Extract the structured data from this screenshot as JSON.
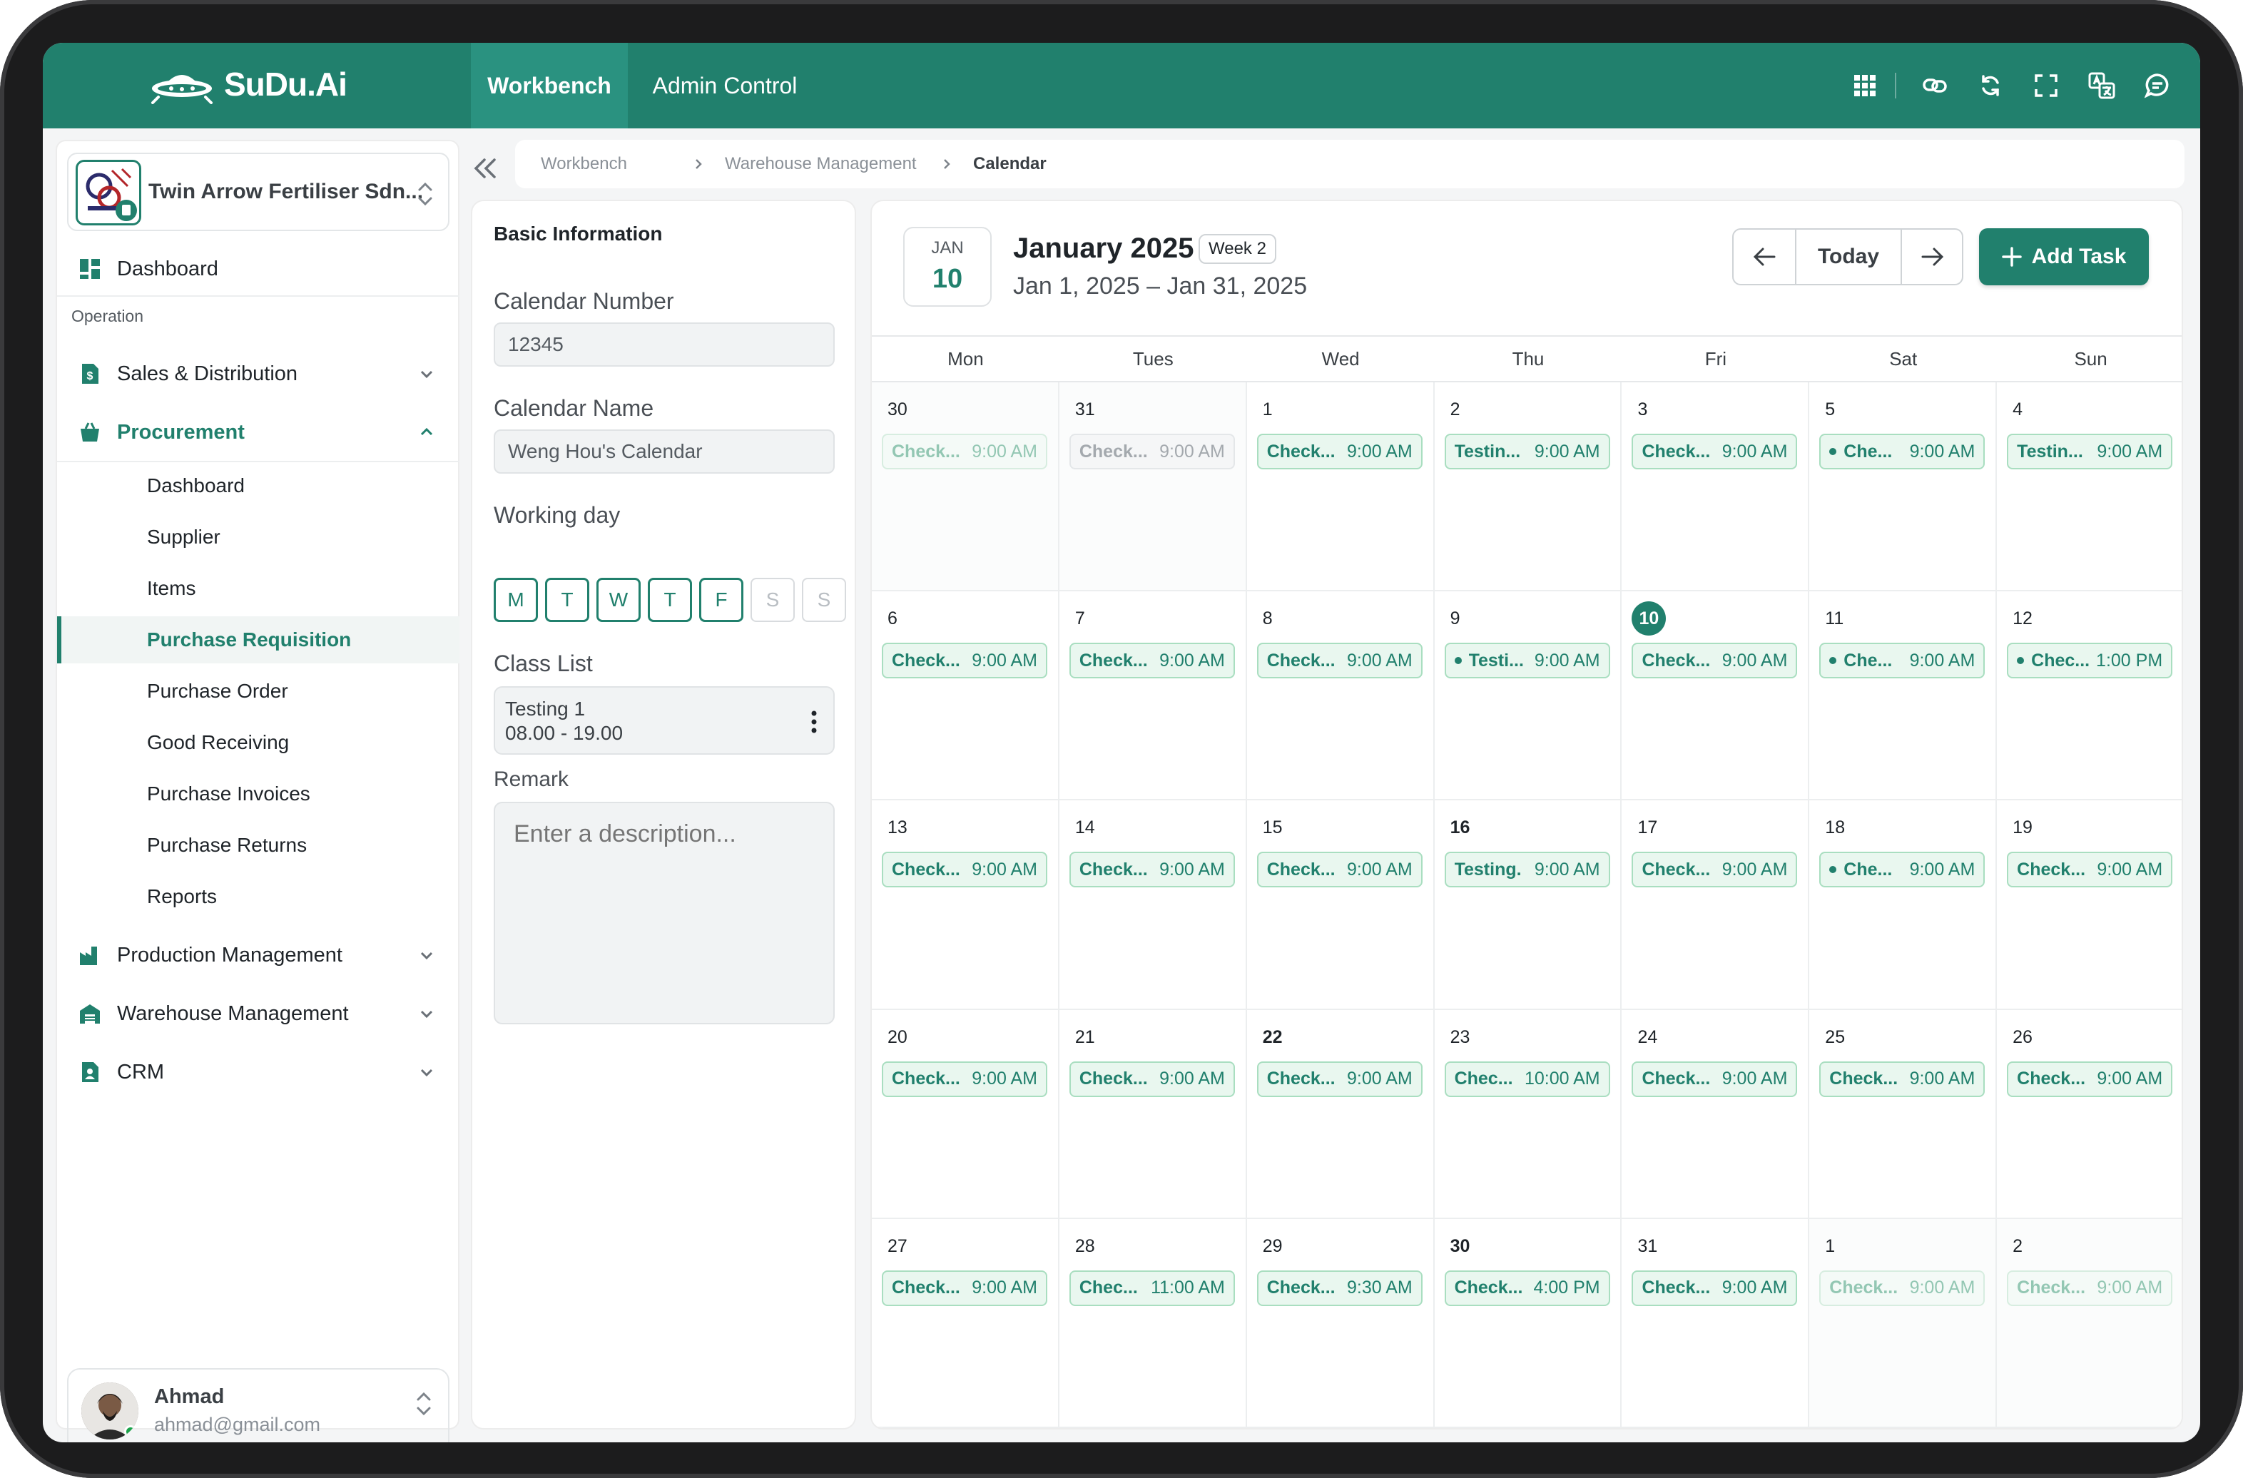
{
  "app": {
    "brand": "SuDu.Ai"
  },
  "topnav": {
    "tabs": [
      "Workbench",
      "Admin Control"
    ]
  },
  "sidebar": {
    "company": "Twin Arrow Fertiliser Sdn...",
    "dashboard": "Dashboard",
    "section": "Operation",
    "groups": [
      "Sales & Distribution",
      "Procurement",
      "Production Management",
      "Warehouse Management",
      "CRM"
    ],
    "procurement_items": [
      "Dashboard",
      "Supplier",
      "Items",
      "Purchase Requisition",
      "Purchase Order",
      "Good Receiving",
      "Purchase Invoices",
      "Purchase Returns",
      "Reports"
    ],
    "user": {
      "name": "Ahmad",
      "email": "ahmad@gmail.com"
    }
  },
  "breadcrumb": [
    "Workbench",
    "Warehouse Management",
    "Calendar"
  ],
  "info": {
    "title": "Basic Information",
    "calendar_number_label": "Calendar Number",
    "calendar_number": "12345",
    "calendar_name_label": "Calendar Name",
    "calendar_name": "Weng Hou's Calendar",
    "working_day_label": "Working day",
    "days": [
      "M",
      "T",
      "W",
      "T",
      "F",
      "S",
      "S"
    ],
    "class_list_label": "Class List",
    "class_name": "Testing 1",
    "class_time": "08.00 - 19.00",
    "remark_label": "Remark",
    "remark_placeholder": "Enter a description..."
  },
  "calendar": {
    "chip_month": "JAN",
    "chip_day": "10",
    "title": "January 2025",
    "week": "Week 2",
    "range": "Jan 1, 2025 – Jan 31, 2025",
    "today": "Today",
    "add_task": "Add Task",
    "weekdays": [
      "Mon",
      "Tues",
      "Wed",
      "Thu",
      "Fri",
      "Sat",
      "Sun"
    ],
    "weeks": [
      [
        {
          "d": "30",
          "t": "Check...",
          "tm": "9:00 AM",
          "s": "faded"
        },
        {
          "d": "31",
          "t": "Check...",
          "tm": "9:00 AM",
          "s": "faded-gray"
        },
        {
          "d": "1",
          "t": "Check...",
          "tm": "9:00 AM"
        },
        {
          "d": "2",
          "t": "Testin...",
          "tm": "9:00 AM"
        },
        {
          "d": "3",
          "t": "Check...",
          "tm": "9:00 AM"
        },
        {
          "d": "5",
          "t": "Che...",
          "tm": "9:00 AM",
          "dot": true
        },
        {
          "d": "4",
          "t": "Testin...",
          "tm": "9:00 AM"
        }
      ],
      [
        {
          "d": "6",
          "t": "Check...",
          "tm": "9:00 AM"
        },
        {
          "d": "7",
          "t": "Check...",
          "tm": "9:00 AM"
        },
        {
          "d": "8",
          "t": "Check...",
          "tm": "9:00 AM"
        },
        {
          "d": "9",
          "t": "Testi...",
          "tm": "9:00 AM",
          "dot": true
        },
        {
          "d": "10",
          "t": "Check...",
          "tm": "9:00 AM",
          "today": true
        },
        {
          "d": "11",
          "t": "Che...",
          "tm": "9:00 AM",
          "dot": true
        },
        {
          "d": "12",
          "t": "Chec...",
          "tm": "1:00 PM",
          "dot": true
        }
      ],
      [
        {
          "d": "13",
          "t": "Check...",
          "tm": "9:00 AM"
        },
        {
          "d": "14",
          "t": "Check...",
          "tm": "9:00 AM"
        },
        {
          "d": "15",
          "t": "Check...",
          "tm": "9:00 AM"
        },
        {
          "d": "16",
          "t": "Testing.",
          "tm": "9:00 AM",
          "bold": true
        },
        {
          "d": "17",
          "t": "Check...",
          "tm": "9:00 AM"
        },
        {
          "d": "18",
          "t": "Che...",
          "tm": "9:00 AM",
          "dot": true
        },
        {
          "d": "19",
          "t": "Check...",
          "tm": "9:00 AM"
        }
      ],
      [
        {
          "d": "20",
          "t": "Check...",
          "tm": "9:00 AM"
        },
        {
          "d": "21",
          "t": "Check...",
          "tm": "9:00 AM"
        },
        {
          "d": "22",
          "t": "Check...",
          "tm": "9:00 AM",
          "bold": true
        },
        {
          "d": "23",
          "t": "Chec...",
          "tm": "10:00 AM"
        },
        {
          "d": "24",
          "t": "Check...",
          "tm": "9:00 AM"
        },
        {
          "d": "25",
          "t": "Check...",
          "tm": "9:00 AM"
        },
        {
          "d": "26",
          "t": "Check...",
          "tm": "9:00 AM"
        }
      ],
      [
        {
          "d": "27",
          "t": "Check...",
          "tm": "9:00 AM"
        },
        {
          "d": "28",
          "t": "Chec...",
          "tm": "11:00 AM"
        },
        {
          "d": "29",
          "t": "Check...",
          "tm": "9:30 AM"
        },
        {
          "d": "30",
          "t": "Check...",
          "tm": "4:00 PM",
          "bold": true
        },
        {
          "d": "31",
          "t": "Check...",
          "tm": "9:00 AM"
        },
        {
          "d": "1",
          "t": "Check...",
          "tm": "9:00 AM",
          "s": "faded"
        },
        {
          "d": "2",
          "t": "Check...",
          "tm": "9:00 AM",
          "s": "faded"
        }
      ]
    ]
  },
  "colors": {
    "brand": "#21806d",
    "brand_light": "#2a9280",
    "event_bg": "#e9f7ef",
    "event_border": "#a9dec0"
  }
}
